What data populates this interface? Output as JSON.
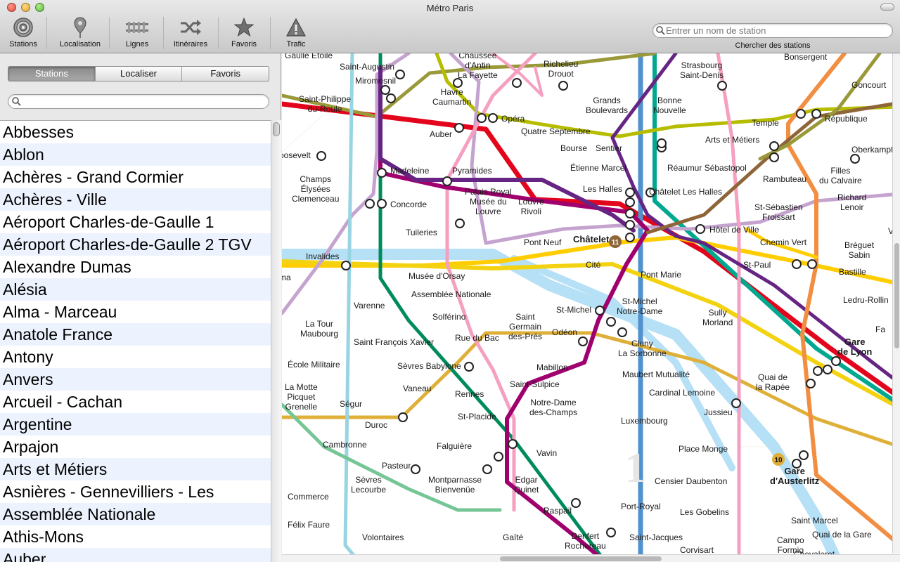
{
  "window": {
    "title": "Métro Paris"
  },
  "toolbar": {
    "items": [
      {
        "label": "Stations",
        "icon": "stations-target-icon"
      },
      {
        "label": "Localisation",
        "icon": "location-pin-icon"
      },
      {
        "label": "Lignes",
        "icon": "rails-icon"
      },
      {
        "label": "Itinéraires",
        "icon": "shuffle-arrows-icon"
      },
      {
        "label": "Favoris",
        "icon": "star-icon"
      },
      {
        "label": "Trafic",
        "icon": "warning-triangle-icon"
      }
    ],
    "search_placeholder": "Entrer un nom de station",
    "search_caption": "Chercher des stations"
  },
  "sidebar": {
    "tabs": [
      {
        "label": "Stations",
        "active": true
      },
      {
        "label": "Localiser",
        "active": false
      },
      {
        "label": "Favoris",
        "active": false
      }
    ],
    "filter_value": "",
    "stations": [
      "Abbesses",
      "Ablon",
      "Achères - Grand Cormier",
      "Achères - Ville",
      "Aéroport Charles-de-Gaulle 1",
      "Aéroport Charles-de-Gaulle 2 TGV",
      "Alexandre Dumas",
      "Alésia",
      "Alma - Marceau",
      "Anatole France",
      "Antony",
      "Anvers",
      "Arcueil - Cachan",
      "Argentine",
      "Arpajon",
      "Arts et Métiers",
      "Asnières - Gennevilliers - Les",
      "Assemblée Nationale",
      "Athis-Mons",
      "Auber"
    ]
  },
  "map": {
    "line_colors": {
      "line1": "#ffcd00",
      "line4": "#a0006e",
      "line7": "#f59fc1",
      "line8": "#c5a3cf",
      "line9": "#b6bd00",
      "line10": "#dfb039",
      "line11": "#8e6538",
      "line12": "#008b5b",
      "line13": "#98d4e2",
      "line14": "#662483",
      "rerA": "#e3051c",
      "rerB": "#5191cd",
      "rerC": "#f3d311",
      "rerD": "#00a88f",
      "line5": "#f28e42",
      "line6": "#75c695",
      "line3": "#9a993a",
      "seine": "#b5e0f5"
    },
    "line_numbers": [
      "1",
      "10",
      "11"
    ],
    "stations": [
      "Chaussée\nd'Antin\nLa Fayette",
      "Richelieu\nDrouot",
      "Strasbourg\nSaint-Denis",
      "Bonsergent",
      "Saint-Augustin",
      "Miromesnil",
      "Goncourt",
      "Havre\nCaumartin",
      "Saint-Philippe\ndu-Roule",
      "Grands\nBoulevards",
      "Bonne\nNouvelle",
      "République",
      "Temple",
      "Auber",
      "Opéra",
      "Quatre Septembre",
      "Bourse",
      "Sentier",
      "Oberkampf",
      "Arts et Métiers",
      "oosevelt",
      "Réaumur Sébastopol",
      "Madeleine",
      "Pyramides",
      "Étienne Marcel",
      "Filles\ndu Calvaire",
      "Champs\nÉlysées\nClemenceau",
      "Rambuteau",
      "Palais Royal\nMusée du\nLouvre",
      "Louvre\nRivoli",
      "Les Halles",
      "Châtelet Les Halles",
      "Richard\nLenoir",
      "Concorde",
      "St-Sébastien\nFroissart",
      "Tuileries",
      "Hôtel de Ville",
      "Volt",
      "Pont Neuf",
      "Châtelet",
      "Chemin Vert",
      "Bréguet\nSabin",
      "Invalides",
      "Cité",
      "St-Paul",
      "Bastille",
      "ma",
      "Musée d'Orsay",
      "Pont Marie",
      "Assemblée Nationale",
      "Ledru-Rollin",
      "Varenne",
      "St-Michel",
      "St-Michel\nNotre-Dame",
      "Sully\nMorland",
      "La Tour\nMaubourg",
      "Solférino",
      "Saint\nGermain\ndes-Prés",
      "Fa",
      "Saint François Xavier",
      "Rue du Bac",
      "Odéon",
      "Cluny\nLa Sorbonne",
      "Gare\nde Lyon",
      "École Militaire",
      "Sèvres Babylone",
      "Mabillon",
      "Maubert Mutualité",
      "Quai de\nla Rapée",
      "La Motte\nPicquet\nGrenelle",
      "Vaneau",
      "Saint-Sulpice",
      "Cardinal Lemoine",
      "Rennes",
      "Ségur",
      "Notre-Dame\ndes-Champs",
      "Jussieu",
      "St-Placide",
      "Duroc",
      "Luxembourg",
      "Cambronne",
      "Falguière",
      "Place Monge",
      "Vavin",
      "Pasteur",
      "Gare\nd'Austerlitz",
      "Sèvres\nLecourbe",
      "Montparnasse\nBienvenüe",
      "Edgar\nQuinet",
      "Censier Daubenton",
      "Commerce",
      "Raspail",
      "Port-Royal",
      "Les Gobelins",
      "Félix Faure",
      "Saint Marcel",
      "Volontaires",
      "Gaîté",
      "Denfert\nRochereau",
      "Saint-Jacques",
      "Campo\nFormio",
      "Quai de la Gare",
      "Corvisart",
      "Chevaleret",
      "e Gaulle Etoile"
    ]
  }
}
